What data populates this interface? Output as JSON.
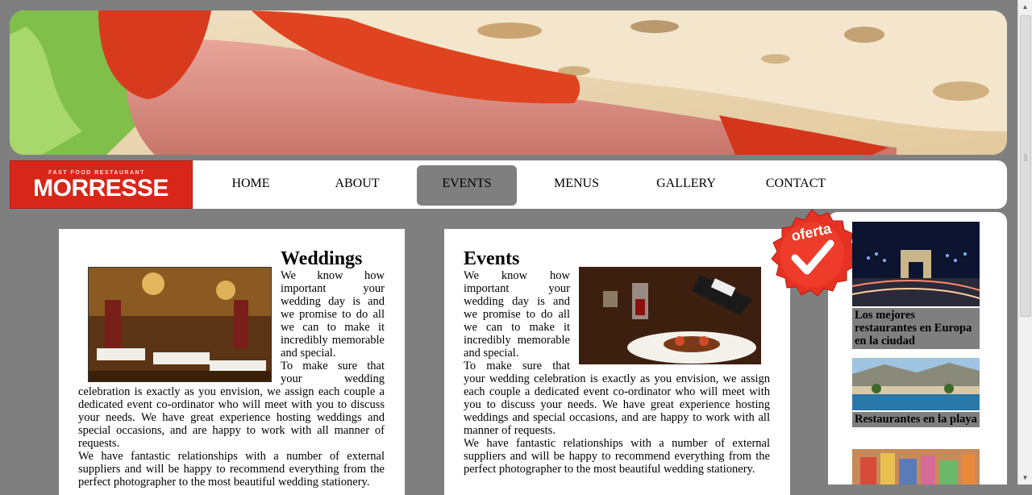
{
  "logo": {
    "tagline": "FAST FOOD RESTAURANT",
    "name": "MORRESSE"
  },
  "nav": {
    "items": [
      {
        "label": "HOME"
      },
      {
        "label": "ABOUT"
      },
      {
        "label": "EVENTS"
      },
      {
        "label": "MENUS"
      },
      {
        "label": "GALLERY"
      },
      {
        "label": "CONTACT"
      }
    ],
    "active": "EVENTS"
  },
  "weddings": {
    "title": "Weddings",
    "para1": "We know how important your wedding day is and we promise to do all we can to make it incredibly memorable and special.",
    "para2": "To make sure that your wedding celebration is exactly as you envision, we assign each couple a dedicated event co-ordinator who will meet with you to discuss your needs. We have great experience hosting weddings and special occasions, and are happy to work with all manner of requests.",
    "para3": "We have fantastic relationships with a number of external suppliers and will be happy to recommend everything from the perfect photographer to the most beautiful wedding stationery."
  },
  "events": {
    "title": "Events",
    "para1": "We know how important your wedding day is and we promise to do all we can to make it incredibly memorable and special.",
    "para2": "To make sure that your wedding celebration is exactly as you envision, we assign each couple a dedicated event co-ordinator who will meet with you to discuss your needs. We have great experience hosting weddings and special occasions, and are happy to work with all manner of requests.",
    "para3": "We have fantastic relationships with a number of external suppliers and will be happy to recommend everything from the perfect photographer to the most beautiful wedding stationery."
  },
  "badge": {
    "text": "oferta"
  },
  "sidebar": {
    "items": [
      {
        "label": "Los mejores restaurantes en Europa en la ciudad"
      },
      {
        "label": "Restaurantes en la playa"
      }
    ]
  },
  "colors": {
    "background": "#7f7f7f",
    "logo_red": "#d8261a",
    "active_nav": "#7f7f7f",
    "badge_red": "#e53222"
  }
}
